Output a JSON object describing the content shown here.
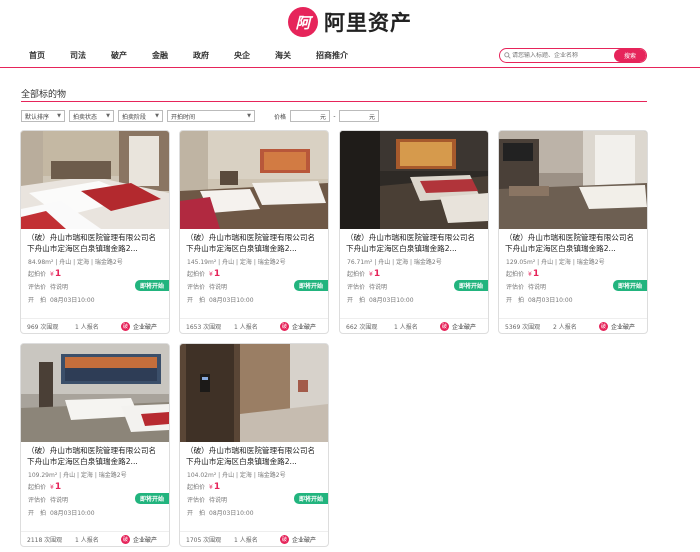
{
  "brand": {
    "logo_glyph": "阿",
    "name": "阿里资产",
    "color": "#e6245a"
  },
  "nav": [
    "首页",
    "司法",
    "破产",
    "金融",
    "政府",
    "央企",
    "海关",
    "招商推介"
  ],
  "search": {
    "placeholder": "请您输入标题、企业名称",
    "button": "搜索"
  },
  "section_title": "全部标的物",
  "filters": {
    "sort": "默认排序",
    "status": "拍卖状态",
    "stage": "拍卖阶段",
    "time": "开拍时间",
    "price_label": "价格",
    "price_min_unit": "元",
    "price_sep": "-",
    "price_max_unit": "元"
  },
  "card_labels": {
    "start_price": "起拍价",
    "currency": "¥",
    "eval": "评估价",
    "start": "开　拍"
  },
  "items": [
    {
      "title": "（破）舟山市瑞和医院管理有限公司名下舟山市定海区白泉镇瑞金路2...",
      "meta": "84.98m² | 舟山 | 定海 | 瑞金路2号",
      "price": "1",
      "eval": "待说明",
      "start_time": "08月03日10:00",
      "status": "即将开始",
      "views": "969 次围观",
      "signups": "1 人报名",
      "tag": "企业破产",
      "tag_icon": "破"
    },
    {
      "title": "（破）舟山市瑞和医院管理有限公司名下舟山市定海区白泉镇瑞金路2...",
      "meta": "145.19m² | 舟山 | 定海 | 瑞金路2号",
      "price": "1",
      "eval": "待说明",
      "start_time": "08月03日10:00",
      "status": "即将开始",
      "views": "1653 次围观",
      "signups": "1 人报名",
      "tag": "企业破产",
      "tag_icon": "破"
    },
    {
      "title": "（破）舟山市瑞和医院管理有限公司名下舟山市定海区白泉镇瑞金路2...",
      "meta": "76.71m² | 舟山 | 定海 | 瑞金路2号",
      "price": "1",
      "eval": "待说明",
      "start_time": "08月03日10:00",
      "status": "即将开始",
      "views": "662 次围观",
      "signups": "1 人报名",
      "tag": "企业破产",
      "tag_icon": "破"
    },
    {
      "title": "（破）舟山市瑞和医院管理有限公司名下舟山市定海区白泉镇瑞金路2...",
      "meta": "129.05m² | 舟山 | 定海 | 瑞金路2号",
      "price": "1",
      "eval": "待说明",
      "start_time": "08月03日10:00",
      "status": "即将开始",
      "views": "5369 次围观",
      "signups": "2 人报名",
      "tag": "企业破产",
      "tag_icon": "破"
    },
    {
      "title": "（破）舟山市瑞和医院管理有限公司名下舟山市定海区白泉镇瑞金路2...",
      "meta": "109.29m² | 舟山 | 定海 | 瑞金路2号",
      "price": "1",
      "eval": "待说明",
      "start_time": "08月03日10:00",
      "status": "即将开始",
      "views": "2118 次围观",
      "signups": "1 人报名",
      "tag": "企业破产",
      "tag_icon": "破"
    },
    {
      "title": "（破）舟山市瑞和医院管理有限公司名下舟山市定海区白泉镇瑞金路2...",
      "meta": "104.02m² | 舟山 | 定海 | 瑞金路2号",
      "price": "1",
      "eval": "待说明",
      "start_time": "08月03日10:00",
      "status": "即将开始",
      "views": "1705 次围观",
      "signups": "1 人报名",
      "tag": "企业破产",
      "tag_icon": "破"
    }
  ]
}
